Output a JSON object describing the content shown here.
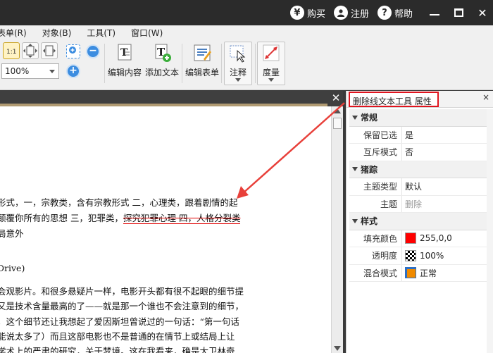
{
  "titlebar": {
    "buy": "购买",
    "buy_glyph": "¥",
    "register": "注册",
    "help": "帮助",
    "help_glyph": "?",
    "close_glyph": "✕"
  },
  "menu": [
    "表单(R)",
    "对象(B)",
    "工具(T)",
    "窗口(W)"
  ],
  "toolbar": {
    "zoom_value": "100%",
    "tools": [
      "编辑内容",
      "添加文本",
      "编辑表单",
      "注释",
      "度量"
    ]
  },
  "document": {
    "close_glyph": "✕",
    "lines": {
      "l1": "形式，一，宗教类，含有宗教形式 二，心理类，跟着剧情的起",
      "l2a": "颠覆你所有的思想 三，犯罪类，",
      "l2b": "探究犯罪心理 四，人格分裂类",
      "l3": "局意外",
      "l4": "Drive)",
      "l5": "会观影片。和很多悬疑片一样，电影开头都有很不起眼的细节提",
      "l6": "又是技术含量最高的了——就是那一个谁也不会注意到的细节，",
      "l7": "，这个细节还让我想起了爱因斯坦曾说过的一句话：“第一句话",
      "l8": "能说太多了）而且这部电影也不是普通的在情节上或结局上让",
      "l9": "学术上的严肃的研究，关于梦境。这在我看来，确是大卫林奇"
    }
  },
  "panel": {
    "title": "删除线文本工具 属性",
    "close_glyph": "×",
    "sections": {
      "general": {
        "title": "常规",
        "rows": [
          {
            "name": "保留已选",
            "value": "是"
          },
          {
            "name": "互斥模式",
            "value": "否"
          }
        ]
      },
      "appearance": {
        "title": "猪踪",
        "rows": [
          {
            "name": "主题类型",
            "value": "默认"
          },
          {
            "name": "主题",
            "value": "删除"
          }
        ]
      },
      "style": {
        "title": "样式",
        "rows": [
          {
            "name": "填充颜色",
            "value": "255,0,0"
          },
          {
            "name": "透明度",
            "value": "100%"
          },
          {
            "name": "混合模式",
            "value": "正常"
          }
        ]
      }
    }
  },
  "colors": {
    "fill": "#ff0000",
    "highlight_border": "#e0141e",
    "arrow": "#e8403a"
  }
}
